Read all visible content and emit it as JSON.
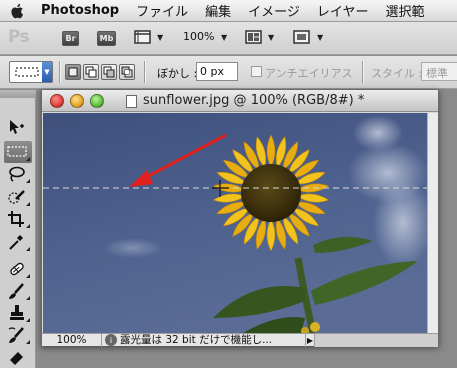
{
  "menubar": {
    "app_name": "Photoshop",
    "items": [
      "ファイル",
      "編集",
      "イメージ",
      "レイヤー",
      "選択範"
    ]
  },
  "appbar": {
    "logo": "Ps",
    "bridge_label": "Br",
    "minibridge_label": "Mb",
    "zoom_level": "100%"
  },
  "options": {
    "feather_label": "ぼかし :",
    "feather_value": "0 px",
    "antialias_label": "アンチエイリアス",
    "antialias_checked": false,
    "style_label": "スタイル :",
    "style_value": "標準"
  },
  "document": {
    "title": "sunflower.jpg @ 100% (RGB/8#) *",
    "status_zoom": "100%",
    "status_text": "露光量は 32 bit だけで機能し..."
  },
  "colors": {
    "accent_blue": "#2a5db0",
    "close_red": "#e0443e",
    "minimize_yellow": "#e6a62a",
    "zoom_green": "#5fbf3c",
    "arrow_red": "#e0201c",
    "sky": "#4a5f8c"
  }
}
